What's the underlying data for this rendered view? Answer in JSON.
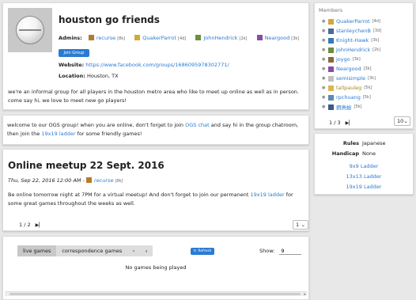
{
  "group": {
    "name": "houston go friends",
    "admins_label": "Admins:",
    "admins": [
      {
        "name": "recurse",
        "rank": "[8k]",
        "color": "#2a7bd3"
      },
      {
        "name": "QuakerParrot",
        "rank": "[4d]",
        "color": "#2a7bd3"
      },
      {
        "name": "JohnHendrick",
        "rank": "[2k]",
        "color": "#2a7bd3"
      },
      {
        "name": "Neargood",
        "rank": "[3k]",
        "color": "#2a7bd3"
      }
    ],
    "join_label": "Join Group",
    "website_label": "Website:",
    "website": "https://www.facebook.com/groups/1686095978302771/",
    "location_label": "Location:",
    "location": "Houston, TX",
    "description": "we're an informal group for all players in the houston metro area who like to meet up online as well as in person. come say hi, we love to meet new go players!"
  },
  "welcome": {
    "part1": "welcome to our OGS group! when you are online, don't forget to join ",
    "link1": "OGS chat",
    "part2": " and say hi in the group chatroom, then join the ",
    "link2": "19x19 ladder",
    "part3": " for some friendly games!"
  },
  "news": {
    "title": "Online meetup 22 Sept. 2016",
    "meta": "Thu, Sep 22, 2016 12:00 AM - ",
    "author": "recurse",
    "author_rank": "[8k]",
    "body1": "Be online tomorrow night at 7PM for a virtual meetup! And don't forget to join our permanent ",
    "body_link": "19x19 ladder",
    "body2": " for some great games throughout the weeks as well.",
    "page": "1 / 2",
    "per_page": "1"
  },
  "games": {
    "tab_live": "live games",
    "tab_corr": "correspondence games",
    "refresh_label": "Refresh",
    "show_label": "Show:",
    "show_value": "9",
    "empty": "No games being played"
  },
  "members": {
    "header": "Members",
    "list": [
      {
        "name": "QuakerParrot",
        "rank": "[4d]",
        "color": "#2a7bd3"
      },
      {
        "name": "stanleychenB",
        "rank": "[3d]",
        "color": "#2a7bd3"
      },
      {
        "name": "Knight-Hawk",
        "rank": "[3k]",
        "color": "#2a7bd3"
      },
      {
        "name": "JohnHendrick",
        "rank": "[2k]",
        "color": "#2a7bd3"
      },
      {
        "name": "joygo",
        "rank": "[3k]",
        "color": "#2a7bd3"
      },
      {
        "name": "Neargood",
        "rank": "[3k]",
        "color": "#2a7bd3"
      },
      {
        "name": "semisimple",
        "rank": "[3k]",
        "color": "#2a7bd3"
      },
      {
        "name": "tallpauleg",
        "rank": "[5k]",
        "color": "#a68a1e"
      },
      {
        "name": "rpchuang",
        "rank": "[5k]",
        "color": "#2a7bd3"
      },
      {
        "name": "鋼鳥蛤",
        "rank": "[5k]",
        "color": "#2a7bd3"
      }
    ],
    "page": "1 / 3",
    "per_page": "10"
  },
  "rules": {
    "rules_label": "Rules",
    "rules_value": "Japanese",
    "handicap_label": "Handicap",
    "handicap_value": "None",
    "ladders": [
      "9x9 Ladder",
      "13x13 Ladder",
      "19x19 Ladder"
    ]
  }
}
